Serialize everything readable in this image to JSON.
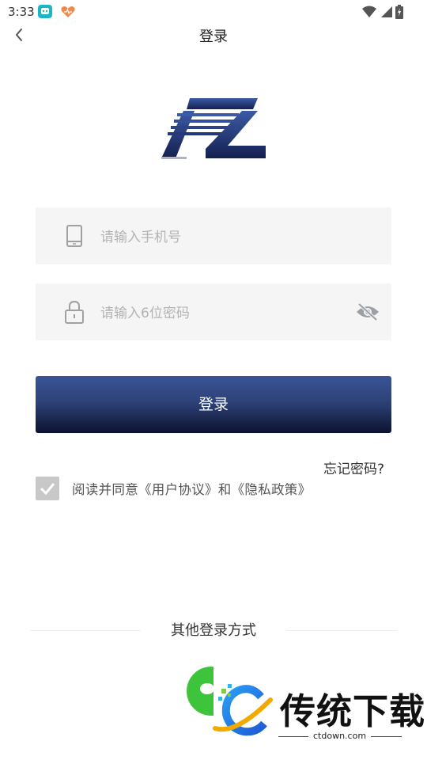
{
  "status_bar": {
    "time": "3:33"
  },
  "nav": {
    "title": "登录"
  },
  "form": {
    "phone_placeholder": "请输入手机号",
    "password_placeholder": "请输入6位密码",
    "login_label": "登录",
    "forgot_label": "忘记密码?",
    "agreement_text": "阅读并同意《用户协议》和《隐私政策》",
    "agreement_checked": true
  },
  "other_login": {
    "title": "其他登录方式",
    "methods": [
      "wechat-icon"
    ]
  },
  "watermark": {
    "brand": "传统下载",
    "url": "ctdown.com"
  },
  "colors": {
    "button_top": "#3a5498",
    "button_bottom": "#0c1230",
    "field_bg": "#f5f5f5",
    "wechat": "#3dc43b"
  }
}
